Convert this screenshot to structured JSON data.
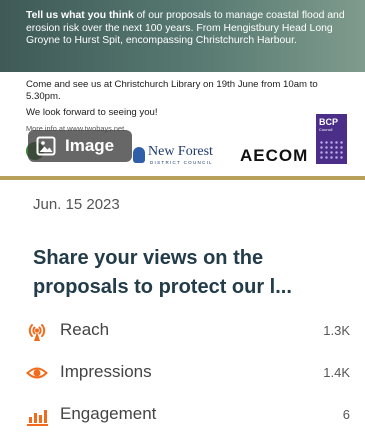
{
  "banner": {
    "headline_bold": "Tell us what you think",
    "headline_rest": " of our proposals to manage coastal flood and erosion risk over the next 100 years. From Hengistbury Head Long Groyne to Hurst Spit, encompassing Christchurch Harbour.",
    "event_line": "Come and see us at Christchurch Library on 19th June from 10am to 5.30pm.",
    "closing_line": "We look forward to seeing you!",
    "more_info": "More info at www.twobays.net",
    "image_chip_label": "Image",
    "logos": {
      "new_forest": "New Forest",
      "new_forest_sub": "DISTRICT COUNCIL",
      "aecom": "AECOM",
      "bcp": "BCP",
      "bcp_sub": "Council"
    }
  },
  "post": {
    "date": "Jun. 15 2023",
    "title": "Share your views on the proposals to protect our l..."
  },
  "metrics": [
    {
      "label": "Reach",
      "value": "1.3K",
      "icon": "broadcast-icon"
    },
    {
      "label": "Impressions",
      "value": "1.4K",
      "icon": "eye-icon"
    },
    {
      "label": "Engagement",
      "value": "6",
      "icon": "bar-chart-icon"
    }
  ],
  "colors": {
    "accent_orange": "#f26b1d",
    "title_navy": "#233c49",
    "gold_bar": "#b9a05a"
  }
}
